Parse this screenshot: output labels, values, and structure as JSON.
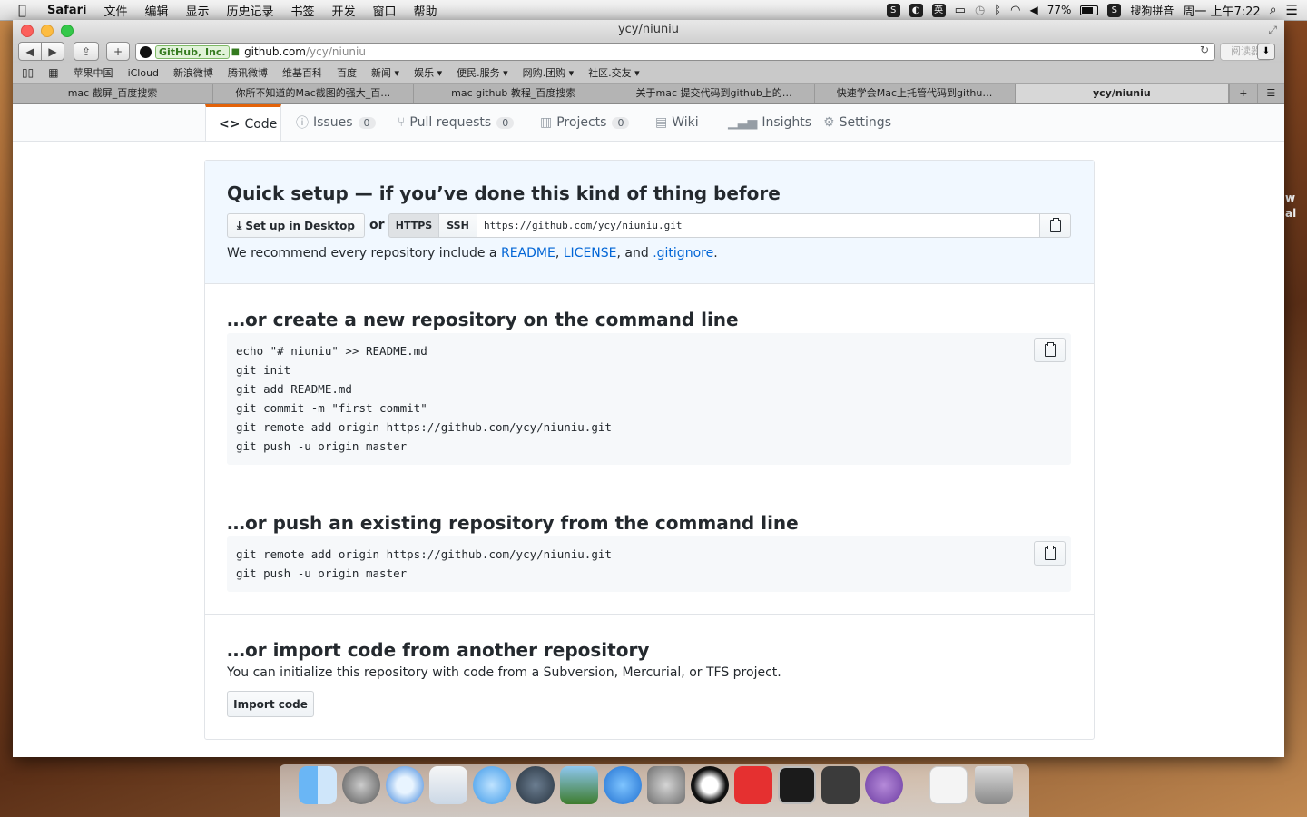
{
  "menubar": {
    "app": "Safari",
    "menus": [
      "文件",
      "编辑",
      "显示",
      "历史记录",
      "书签",
      "开发",
      "窗口",
      "帮助"
    ],
    "battery": "77%",
    "input_method": "搜狗拼音",
    "ime_label": "英",
    "clock": "周一 上午7:22"
  },
  "window": {
    "title": "ycy/niuniu",
    "url_ev": "GitHub, Inc.",
    "url_domain": "github.com",
    "url_path": "/ycy/niuniu",
    "reader": "阅读器"
  },
  "bookmarks": [
    "苹果中国",
    "iCloud",
    "新浪微博",
    "腾讯微博",
    "维基百科",
    "百度",
    "新闻 ▾",
    "娱乐 ▾",
    "便民.服务 ▾",
    "网购.团购 ▾",
    "社区.交友 ▾"
  ],
  "tabs": [
    {
      "label": "mac 截屏_百度搜索"
    },
    {
      "label": "你所不知道的Mac截图的强大_百…"
    },
    {
      "label": "mac github 教程_百度搜索"
    },
    {
      "label": "关于mac 提交代码到github上的…"
    },
    {
      "label": "快速学会Mac上托管代码到githu…"
    },
    {
      "label": "ycy/niuniu"
    }
  ],
  "repo_nav": {
    "code": "Code",
    "issues": "Issues",
    "issues_count": "0",
    "pulls": "Pull requests",
    "pulls_count": "0",
    "projects": "Projects",
    "projects_count": "0",
    "wiki": "Wiki",
    "insights": "Insights",
    "settings": "Settings"
  },
  "quick_setup": {
    "title": "Quick setup — if you’ve done this kind of thing before",
    "desktop_btn": "Set up in Desktop",
    "or": "or",
    "https": "HTTPS",
    "ssh": "SSH",
    "clone_url": "https://github.com/ycy/niuniu.git",
    "recommend_pre": "We recommend every repository include a ",
    "readme": "README",
    "comma": ", ",
    "license": "LICENSE",
    "and": ", and ",
    "gitignore": ".gitignore",
    "period": "."
  },
  "create_new": {
    "title": "…or create a new repository on the command line",
    "lines": [
      "echo \"# niuniu\" >> README.md",
      "git init",
      "git add README.md",
      "git commit -m \"first commit\"",
      "git remote add origin https://github.com/ycy/niuniu.git",
      "git push -u origin master"
    ]
  },
  "push_existing": {
    "title": "…or push an existing repository from the command line",
    "lines": [
      "git remote add origin https://github.com/ycy/niuniu.git",
      "git push -u origin master"
    ]
  },
  "import": {
    "title": "…or import code from another repository",
    "desc": "You can initialize this repository with code from a Subversion, Mercurial, or TFS project.",
    "button": "Import code"
  },
  "desktop_side_text": [
    "w",
    "al"
  ]
}
